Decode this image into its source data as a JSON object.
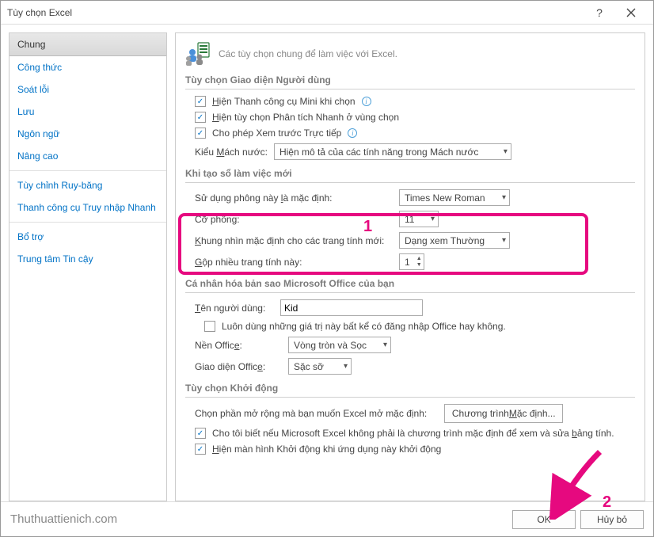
{
  "window": {
    "title": "Tùy chọn Excel"
  },
  "sidebar": {
    "items": [
      {
        "label": "Chung",
        "selected": true
      },
      {
        "label": "Công thức"
      },
      {
        "label": "Soát lỗi"
      },
      {
        "label": "Lưu"
      },
      {
        "label": "Ngôn ngữ"
      },
      {
        "label": "Nâng cao"
      }
    ],
    "items2": [
      {
        "label": "Tùy chỉnh Ruy-băng"
      },
      {
        "label": "Thanh công cụ Truy nhập Nhanh"
      }
    ],
    "items3": [
      {
        "label": "Bổ trợ"
      },
      {
        "label": "Trung tâm Tin cậy"
      }
    ]
  },
  "main": {
    "header": "Các tùy chọn chung để làm việc với Excel.",
    "section_ui": {
      "title": "Tùy chọn Giao diện Người dùng",
      "opt1": "Hiện Thanh công cụ Mini khi chọn",
      "opt2": "Hiện tùy chọn Phân tích Nhanh ở vùng chọn",
      "opt3": "Cho phép Xem trước Trực tiếp",
      "style_label_pre": "Kiểu ",
      "style_label_u": "M",
      "style_label_post": "ách nước:",
      "style_value": "Hiện mô tả của các tính năng trong Mách nước"
    },
    "section_new": {
      "title": "Khi tạo sổ làm việc mới",
      "font_label_pre": "Sử dụng phông này ",
      "font_label_u": "l",
      "font_label_post": "à mặc định:",
      "font_value": "Times New Roman",
      "size_label_pre": "Cỡ phôn",
      "size_label_u": "g",
      "size_label_post": ":",
      "size_value": "11",
      "view_label_pre": "",
      "view_label_u": "K",
      "view_label_post": "hung nhìn mặc định cho các trang tính mới:",
      "view_value": "Dạng xem Thường",
      "sheets_label_pre": "",
      "sheets_label_u": "G",
      "sheets_label_post": "ộp nhiều trang tính này:",
      "sheets_value": "1"
    },
    "section_personal": {
      "title": "Cá nhân hóa bản sao Microsoft Office của bạn",
      "user_label_pre": "",
      "user_label_u": "T",
      "user_label_post": "ên người dùng:",
      "user_value": "Kid",
      "always_label": "Luôn dùng những giá trị này bất kể có đăng nhập Office hay không.",
      "bg_label_pre": "Nền Offic",
      "bg_label_u": "e",
      "bg_label_post": ":",
      "bg_value": "Vòng tròn và Sọc",
      "theme_label_pre": "Giao diện Offic",
      "theme_label_u": "e",
      "theme_label_post": ":",
      "theme_value": "Sặc sỡ"
    },
    "section_startup": {
      "title": "Tùy chọn Khởi động",
      "ext_label": "Chọn phần mở rộng mà bạn muốn Excel mở mặc định:",
      "ext_btn_pre": "Chương trình ",
      "ext_btn_u": "M",
      "ext_btn_post": "ặc định...",
      "notify_label_pre": "Cho tôi biết nếu Microsoft Excel không phải là chương trình mặc định để xem và sửa ",
      "notify_label_u": "b",
      "notify_label_post": "ảng tính.",
      "splash_label_pre": "",
      "splash_label_u": "H",
      "splash_label_post": "iện màn hình Khởi động khi ứng dụng này khởi động"
    }
  },
  "callouts": {
    "one": "1",
    "two": "2"
  },
  "footer": {
    "watermark": "Thuthuattienich.com",
    "ok": "OK",
    "cancel": "Hủy bỏ"
  }
}
